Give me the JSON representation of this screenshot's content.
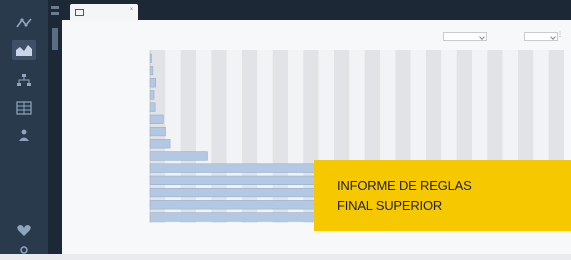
{
  "tab": {
    "label": ""
  },
  "page_title": "",
  "toolbar": {
    "filter_label": "",
    "filter_value": "",
    "metric_label": "",
    "metric_value": "",
    "more_label": "⋮"
  },
  "promo": {
    "line1": "INFORME DE REGLAS",
    "line2": "FINAL SUPERIOR"
  },
  "chart_data": {
    "type": "bar",
    "orientation": "horizontal",
    "categories": [
      "",
      "",
      "",
      "",
      "",
      "",
      "",
      "",
      "",
      "",
      "",
      "",
      "",
      ""
    ],
    "values": [
      2,
      5,
      10,
      7,
      9,
      23,
      27,
      35,
      100,
      310,
      315,
      320,
      325,
      720
    ],
    "value_labels": [
      "",
      "",
      "",
      "",
      "",
      "",
      "",
      "",
      "",
      "",
      "",
      "",
      "",
      ""
    ],
    "x_ticks": [
      "",
      "",
      "",
      "",
      "",
      "",
      "",
      "",
      "",
      "",
      "",
      "",
      "",
      "",
      "",
      "",
      "",
      "",
      "",
      "",
      "",
      "",
      "",
      "",
      "",
      "",
      ""
    ],
    "xlim": [
      0,
      720
    ],
    "grid": true,
    "colors": {
      "bar": "#b3c8e2",
      "bar_border": "#8fa8c8",
      "band": "#e2e3e6",
      "band_alt": "#f2f3f5"
    }
  }
}
